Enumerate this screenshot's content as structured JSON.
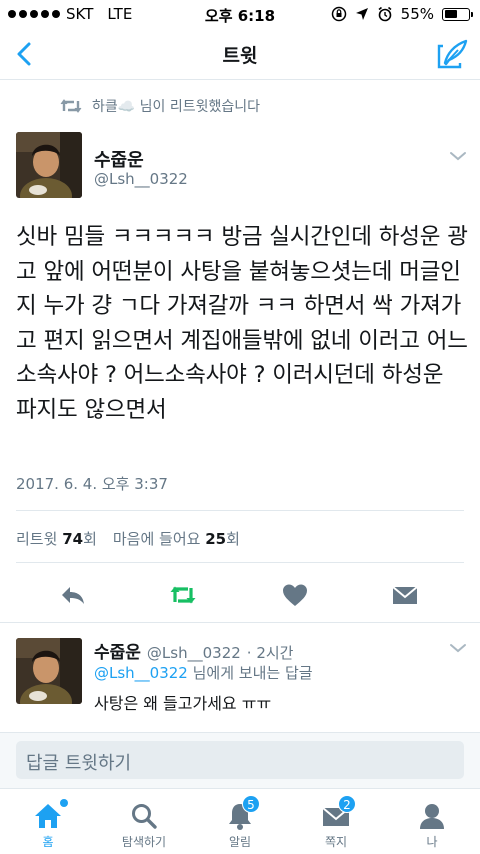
{
  "status_bar": {
    "carrier": "SKT",
    "network": "LTE",
    "time": "오후 6:18",
    "battery": "55%",
    "battery_level": 0.55,
    "signal_bars": 5
  },
  "nav": {
    "title": "트윗",
    "back_icon": "chevron-left-icon",
    "compose_icon": "compose-tweet-icon"
  },
  "retweet_context": {
    "text": "하클☁️ 님이 리트윗했습니다"
  },
  "tweet": {
    "author_name": "수줍운",
    "author_handle": "@Lsh__0322",
    "text": "싯바 밈들 ㅋㅋㅋㅋㅋ 방금 실시간인데 하성운 광고 앞에 어떤분이 사탕을 붙혀놓으셧는데 머글인지 누가 걍 ㄱ다 가져갈까 ㅋㅋ 하면서 싹 가져가고 편지 읽으면서 계집애들밖에 없네 이러고 어느 소속사야 ? 어느소속사야 ? 이러시던데 하성운 파지도 않으면서",
    "date": "2017. 6. 4. 오후 3:37",
    "retweets_label": "리트윗",
    "retweets_count": "74",
    "retweets_suffix": "회",
    "likes_label": "마음에 들어요",
    "likes_count": "25",
    "likes_suffix": "회"
  },
  "reply": {
    "author_name": "수줍운",
    "author_handle": "@Lsh__0322",
    "time": "· 2시간",
    "reply_to_handle": "@Lsh__0322",
    "reply_to_suffix": " 님에게 보내는 답글",
    "text": "사탕은 왜 들고가세요 ㅠㅠ"
  },
  "compose": {
    "placeholder": "답글 트윗하기"
  },
  "tabs": [
    {
      "label": "홈",
      "icon": "home-icon",
      "active": true
    },
    {
      "label": "탐색하기",
      "icon": "search-icon",
      "active": false
    },
    {
      "label": "알림",
      "icon": "bell-icon",
      "badge": "5",
      "active": false
    },
    {
      "label": "쪽지",
      "icon": "envelope-icon",
      "badge": "2",
      "active": false
    },
    {
      "label": "나",
      "icon": "profile-icon",
      "active": false
    }
  ],
  "colors": {
    "accent": "#1da1f2",
    "retweet_green": "#17bf63",
    "secondary_text": "#657786"
  }
}
